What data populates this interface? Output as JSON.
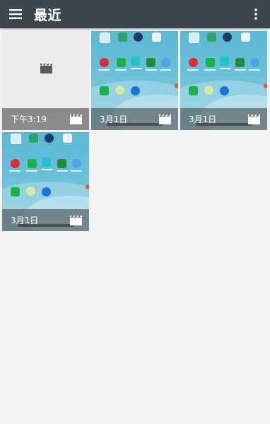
{
  "appbar": {
    "title": "最近",
    "menu_icon": "hamburger-menu-icon",
    "more_icon": "more-vert-icon"
  },
  "items": [
    {
      "kind": "video-placeholder",
      "label": "下午3:19",
      "type_icon": "video-clapper-icon"
    },
    {
      "kind": "screenshot",
      "label": "3月1日",
      "type_icon": "video-clapper-icon"
    },
    {
      "kind": "screenshot",
      "label": "3月1日",
      "type_icon": "video-clapper-icon"
    },
    {
      "kind": "screenshot",
      "label": "3月1日",
      "type_icon": "video-clapper-icon"
    }
  ],
  "colors": {
    "appbar": "#3c474d",
    "background": "#f2f2f2",
    "caption_overlay": "rgba(60,60,60,0.55)"
  }
}
